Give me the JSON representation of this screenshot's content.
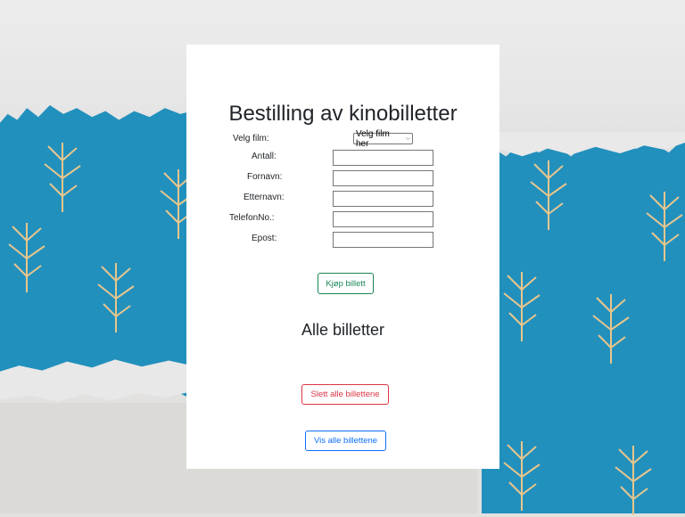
{
  "page": {
    "title": "Bestilling av kinobilletter",
    "subtitle": "Alle billetter"
  },
  "form": {
    "film_label": "Velg film:",
    "film_select_value": "Velg film her",
    "fields": [
      {
        "label": "Antall:",
        "value": ""
      },
      {
        "label": "Fornavn:",
        "value": ""
      },
      {
        "label": "Etternavn:",
        "value": ""
      },
      {
        "label": "TelefonNo.:",
        "value": ""
      },
      {
        "label": "Epost:",
        "value": ""
      }
    ],
    "buy_button": "Kjøp billett"
  },
  "actions": {
    "delete_all": "Slett alle billettene",
    "show_all": "Vis alle billettene"
  },
  "colors": {
    "background_blue": "#2290bd",
    "success": "#198754",
    "danger": "#dc3545",
    "primary": "#0d6efd",
    "sprig": "#f3c98a"
  },
  "icons": {
    "select_chevron": "chevron-down-icon",
    "background_decoration": "sprig-icon"
  }
}
